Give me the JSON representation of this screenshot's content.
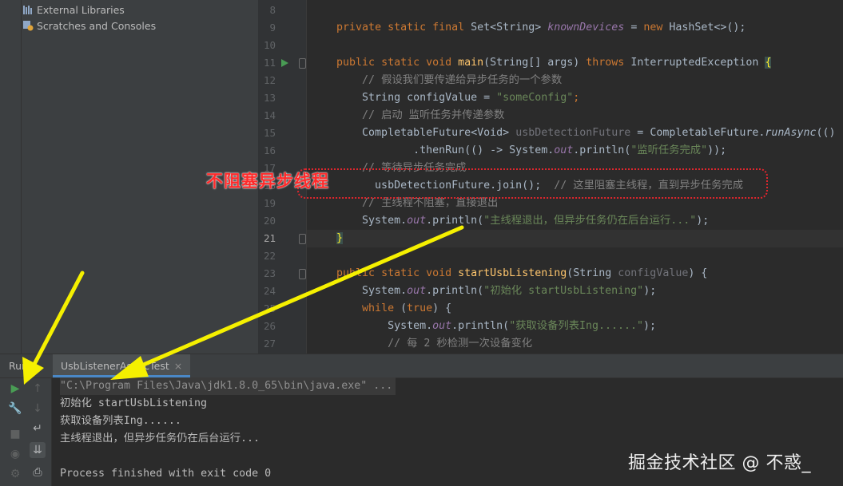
{
  "project_tree": [
    {
      "label": "External Libraries",
      "icon": "library-icon"
    },
    {
      "label": "Scratches and Consoles",
      "icon": "scratches-icon"
    }
  ],
  "editor": {
    "line_numbers": [
      "8",
      "9",
      "10",
      "11",
      "12",
      "13",
      "14",
      "15",
      "16",
      "17",
      "18",
      "19",
      "20",
      "21",
      "22",
      "23",
      "24",
      "25",
      "26",
      "27"
    ],
    "current_line": "21",
    "lines": [
      [],
      [
        {
          "t": "    "
        },
        {
          "t": "private static final ",
          "c": "kw"
        },
        {
          "t": "Set<String> "
        },
        {
          "t": "knownDevices",
          "c": "fi"
        },
        {
          "t": " = "
        },
        {
          "t": "new ",
          "c": "kw"
        },
        {
          "t": "HashSet<>();"
        }
      ],
      [],
      [
        {
          "t": "    "
        },
        {
          "t": "public static void ",
          "c": "kw"
        },
        {
          "t": "main",
          "c": "fn"
        },
        {
          "t": "(String[] args) "
        },
        {
          "t": "throws ",
          "c": "kw"
        },
        {
          "t": "InterruptedException "
        },
        {
          "t": "{",
          "c": "brace-hl"
        }
      ],
      [
        {
          "t": "        "
        },
        {
          "t": "// 假设我们要传递给异步任务的一个参数",
          "c": "cm"
        }
      ],
      [
        {
          "t": "        String configValue = "
        },
        {
          "t": "\"someConfig\"",
          "c": "st"
        },
        {
          "t": ";",
          "c": "kw"
        }
      ],
      [
        {
          "t": "        "
        },
        {
          "t": "// 启动 监听任务并传递参数",
          "c": "cm"
        }
      ],
      [
        {
          "t": "        CompletableFuture<Void> "
        },
        {
          "t": "usbDetectionFuture",
          "c": "par"
        },
        {
          "t": " = CompletableFuture."
        },
        {
          "t": "runAsync",
          "c": "ifn"
        },
        {
          "t": "(()"
        }
      ],
      [
        {
          "t": "                .thenRun(() -> System."
        },
        {
          "t": "out",
          "c": "sf"
        },
        {
          "t": ".println("
        },
        {
          "t": "\"监听任务完成\"",
          "c": "st"
        },
        {
          "t": "));"
        }
      ],
      [
        {
          "t": "        "
        },
        {
          "t": "// 等待异步任务完成",
          "c": "cm"
        }
      ],
      [
        {
          "t": "          usbDetectionFuture.join();  "
        },
        {
          "t": "// 这里阻塞主线程，直到异步任务完成",
          "c": "cm"
        }
      ],
      [
        {
          "t": "        "
        },
        {
          "t": "// 主线程不阻塞，直接退出",
          "c": "cm"
        }
      ],
      [
        {
          "t": "        System."
        },
        {
          "t": "out",
          "c": "sf"
        },
        {
          "t": ".println("
        },
        {
          "t": "\"主线程退出，但异步任务仍在后台运行...\"",
          "c": "st"
        },
        {
          "t": ");"
        }
      ],
      [
        {
          "t": "    "
        },
        {
          "t": "}",
          "c": "brace-hl"
        }
      ],
      [],
      [
        {
          "t": "    "
        },
        {
          "t": "public static void ",
          "c": "kw"
        },
        {
          "t": "startUsbListening",
          "c": "fn"
        },
        {
          "t": "(String "
        },
        {
          "t": "configValue",
          "c": "par"
        },
        {
          "t": ") {"
        }
      ],
      [
        {
          "t": "        System."
        },
        {
          "t": "out",
          "c": "sf"
        },
        {
          "t": ".println("
        },
        {
          "t": "\"初始化 startUsbListening\"",
          "c": "st"
        },
        {
          "t": ");"
        }
      ],
      [
        {
          "t": "        "
        },
        {
          "t": "while ",
          "c": "kw"
        },
        {
          "t": "("
        },
        {
          "t": "true",
          "c": "kw"
        },
        {
          "t": ") {"
        }
      ],
      [
        {
          "t": "            System."
        },
        {
          "t": "out",
          "c": "sf"
        },
        {
          "t": ".println("
        },
        {
          "t": "\"获取设备列表Ing......\"",
          "c": "st"
        },
        {
          "t": ");"
        }
      ],
      [
        {
          "t": "            "
        },
        {
          "t": "// 每 2 秒检测一次设备变化",
          "c": "cm"
        }
      ]
    ]
  },
  "annotation": {
    "label": "不阻塞异步线程",
    "color": "#e0262d"
  },
  "run_panel": {
    "title": "Run:",
    "tab_label": "UsbListenerAsyncTest",
    "tab_close": "×",
    "output_lines": [
      {
        "text": "\"C:\\Program Files\\Java\\jdk1.8.0_65\\bin\\java.exe\" ...",
        "kind": "cmd"
      },
      {
        "text": "初始化 startUsbListening",
        "kind": "out"
      },
      {
        "text": "获取设备列表Ing......",
        "kind": "out"
      },
      {
        "text": "主线程退出，但异步任务仍在后台运行...",
        "kind": "out"
      },
      {
        "text": "",
        "kind": "out"
      },
      {
        "text": "Process finished with exit code 0",
        "kind": "out"
      }
    ],
    "toolbar": [
      {
        "name": "rerun-icon",
        "glyph": "▶"
      },
      {
        "name": "settings-wrench-icon",
        "glyph": "🔧"
      },
      {
        "name": "stop-icon",
        "glyph": "■"
      },
      {
        "name": "camera-icon",
        "glyph": "◉"
      },
      {
        "name": "gear-icon",
        "glyph": "⚙"
      },
      {
        "name": "up-arrow-icon",
        "glyph": "↑"
      },
      {
        "name": "down-arrow-icon",
        "glyph": "↓"
      },
      {
        "name": "soft-wrap-icon",
        "glyph": "↵"
      },
      {
        "name": "scroll-to-end-icon",
        "glyph": "⇊"
      },
      {
        "name": "print-icon",
        "glyph": "⎙"
      }
    ]
  },
  "watermark": "掘金技术社区 @ 不惑_",
  "colors": {
    "arrow": "#f5f000",
    "accent": "#4a88c7",
    "run_green": "#499c54"
  }
}
